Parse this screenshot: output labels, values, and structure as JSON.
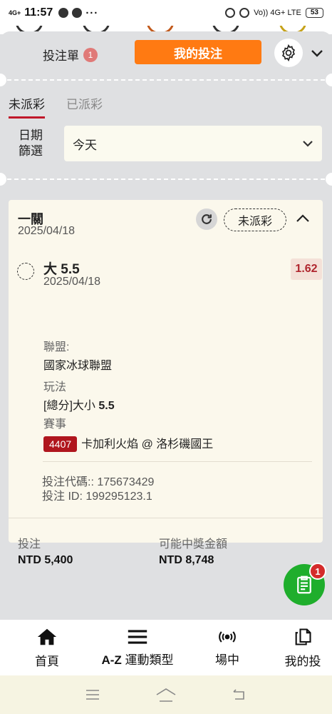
{
  "status_bar": {
    "network": "4G+",
    "time": "11:57",
    "dots": "···",
    "right_text": "Vo)) 4G+ LTE",
    "battery": "53"
  },
  "header": {
    "bet_slip_label": "投注單",
    "bet_slip_count": "1",
    "my_bets_label": "我的投注"
  },
  "filter_tabs": [
    {
      "label": "未派彩",
      "active": true
    },
    {
      "label": "已派彩",
      "active": false
    }
  ],
  "date_filter": {
    "label_line1": "日期",
    "label_line2": "篩選",
    "value": "今天"
  },
  "bet": {
    "type": "一關",
    "date": "2025/04/18",
    "status": "未派彩",
    "selection": {
      "name": "大 5.5",
      "date": "2025/04/18",
      "odds": "1.62"
    },
    "league_label": "聯盟:",
    "league": "國家冰球聯盟",
    "market_label": "玩法",
    "market_prefix": "[總分]大小 ",
    "market_line": "5.5",
    "event_label": "賽事",
    "event_id": "4407",
    "event_name": "卡加利火焰 @ 洛杉磯國王",
    "bet_code": "投注代碼:: 175673429",
    "bet_id": "投注 ID: 199295123.1",
    "stake_label": "投注",
    "stake": "NTD 5,400",
    "payout_label": "可能中獎金額",
    "payout": "NTD 8,748"
  },
  "floating_slip": {
    "count": "1"
  },
  "bottom_nav": [
    {
      "label": "首頁",
      "icon": "home-icon"
    },
    {
      "label_bold": "A-Z",
      "label": " 運動類型",
      "icon": "menu-icon"
    },
    {
      "label": "場中",
      "icon": "live-icon"
    },
    {
      "label": "我的投",
      "icon": "copy-icon"
    }
  ]
}
